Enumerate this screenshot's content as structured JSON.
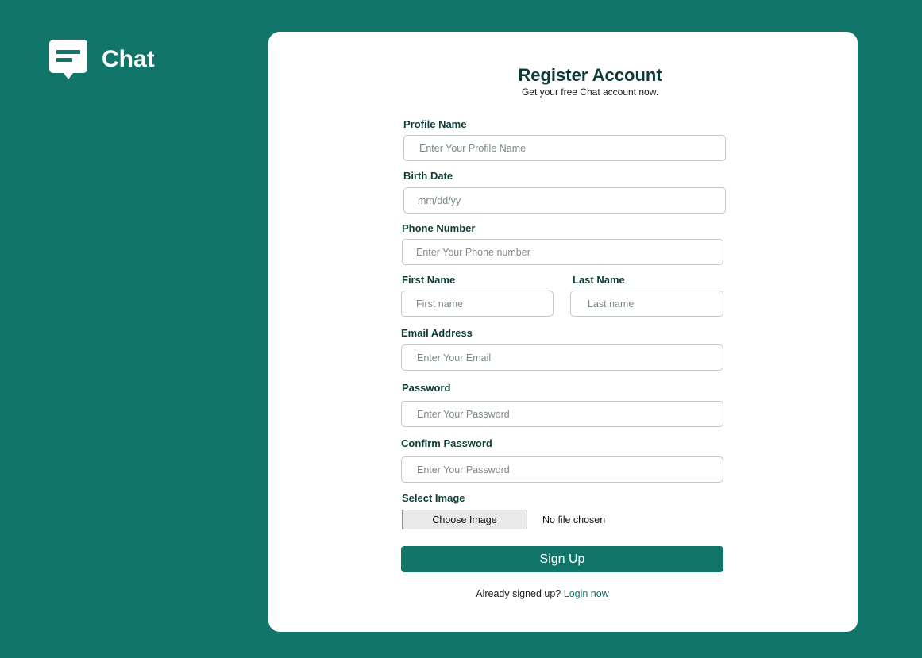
{
  "brand": {
    "name": "Chat"
  },
  "colors": {
    "primary": "#12756a",
    "heading": "#0d3c37",
    "card": "#ffffff"
  },
  "form": {
    "title": "Register Account",
    "subtitle": "Get your free Chat account now.",
    "profile_name": {
      "label": "Profile Name",
      "placeholder": "Enter Your Profile Name"
    },
    "birth_date": {
      "label": "Birth Date",
      "placeholder": "mm/dd/yy"
    },
    "phone": {
      "label": "Phone Number",
      "placeholder": "Enter Your Phone number"
    },
    "first_name": {
      "label": "First Name",
      "placeholder": "First name"
    },
    "last_name": {
      "label": "Last Name",
      "placeholder": "Last name"
    },
    "email": {
      "label": "Email Address",
      "placeholder": "Enter Your Email"
    },
    "password": {
      "label": "Password",
      "placeholder": "Enter Your Password"
    },
    "confirm_password": {
      "label": "Confirm Password",
      "placeholder": "Enter Your Password"
    },
    "image": {
      "label": "Select Image",
      "button_label": "Choose Image",
      "status": "No file chosen"
    },
    "submit_label": "Sign Up",
    "footer": {
      "prompt": "Already signed up?",
      "link_label": "Login now"
    }
  },
  "icons": {
    "logo": "chat-bubble-icon"
  }
}
